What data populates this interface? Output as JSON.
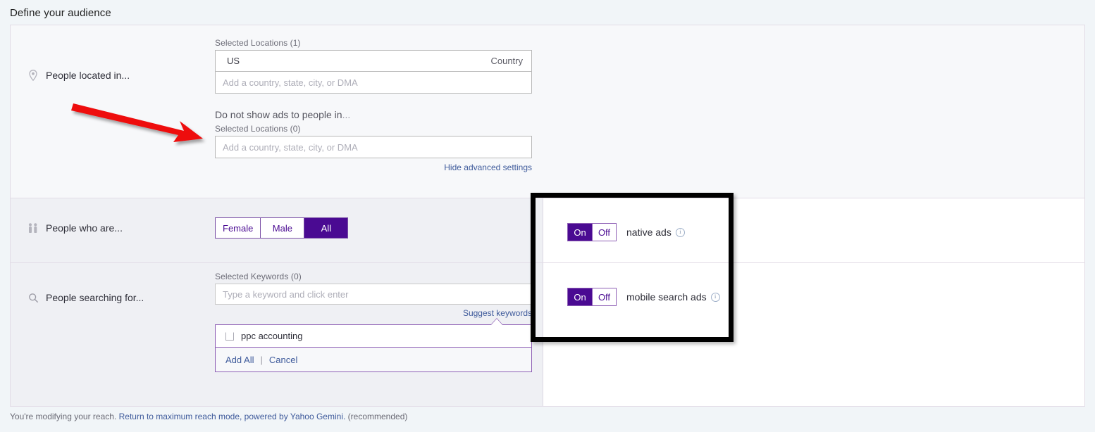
{
  "page": {
    "title": "Define your audience"
  },
  "sections": {
    "location": {
      "label": "People located in...",
      "icon": "map-pin-icon",
      "selected_caption": "Selected Locations (1)",
      "selected": [
        {
          "name": "US",
          "kind": "Country"
        }
      ],
      "input_placeholder": "Add a country, state, city, or DMA",
      "exclude_heading": "Do not show ads to people in",
      "exclude_heading_ellipsis": "...",
      "exclude_caption": "Selected Locations (0)",
      "exclude_placeholder": "Add a country, state, city, or DMA",
      "advanced_link": "Hide advanced settings"
    },
    "gender": {
      "label": "People who are...",
      "icon": "people-icon",
      "options": [
        "Female",
        "Male",
        "All"
      ],
      "selected": "All"
    },
    "keywords": {
      "label": "People searching for...",
      "icon": "search-icon",
      "caption": "Selected Keywords (0)",
      "input_placeholder": "Type a keyword and click enter",
      "suggest_link": "Suggest keywords",
      "suggestions": [
        "ppc accounting"
      ],
      "add_all_label": "Add All",
      "separator": "|",
      "cancel_label": "Cancel"
    }
  },
  "ad_formats": [
    {
      "label": "native ads",
      "on_label": "On",
      "off_label": "Off",
      "state": "On",
      "info": "i"
    },
    {
      "label": "mobile search ads",
      "on_label": "On",
      "off_label": "Off",
      "state": "On",
      "info": "i"
    }
  ],
  "footer": {
    "prefix": "You're modifying your reach.",
    "link": "Return to maximum reach mode, powered by Yahoo Gemini.",
    "suffix": "(recommended)"
  },
  "colors": {
    "accent_purple": "#4a0a92",
    "link_blue": "#3e5a9b",
    "annotation_red": "#ee1111",
    "annotation_black": "#000000"
  }
}
